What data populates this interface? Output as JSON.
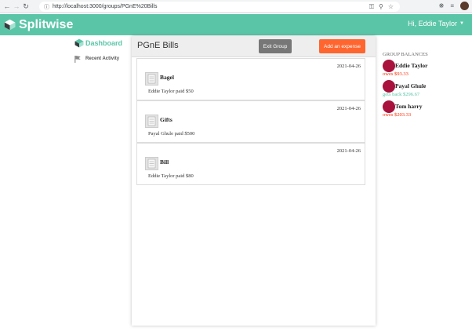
{
  "browser": {
    "url": "http://localhost:3000/groups/PGnE%20Bills"
  },
  "header": {
    "brand": "Splitwise",
    "user_greeting": "Hi, Eddie Taylor"
  },
  "nav": {
    "dashboard": "Dashboard",
    "recent_activity": "Recent Activity"
  },
  "group": {
    "title": "PGnE Bills",
    "exit_label": "Exit Group",
    "add_label": "Add an expense"
  },
  "expenses": [
    {
      "date": "2021-04-26",
      "name": "Bagel",
      "paid": "Eddie Taylor paid $50"
    },
    {
      "date": "2021-04-26",
      "name": "Gifts",
      "paid": "Payal Ghule paid $500"
    },
    {
      "date": "2021-04-26",
      "name": "Bill",
      "paid": "Eddie Taylor paid $80"
    }
  ],
  "balances": {
    "title": "GROUP BALANCES",
    "items": [
      {
        "name": "Eddie Taylor",
        "amount": "owes $93.33",
        "status": "owes"
      },
      {
        "name": "Payal Ghule",
        "amount": "gets back $296.67",
        "status": "gets"
      },
      {
        "name": "Tom harry",
        "amount": "owes $203.33",
        "status": "owes"
      }
    ]
  },
  "colors": {
    "brand": "#5bc5a7",
    "accent": "#ff652f",
    "owes": "#ff2900",
    "avatar": "#a8123c"
  },
  "icons": {
    "back": "arrow-left-icon",
    "forward": "arrow-right-icon",
    "reload": "reload-icon",
    "info": "info-icon",
    "key": "key-icon",
    "zoom": "zoom-icon",
    "star": "star-icon",
    "extensions": "puzzle-icon",
    "queue": "queue-icon",
    "dashboard": "dashboard-icon",
    "activity": "flag-icon",
    "expense": "receipt-icon"
  }
}
